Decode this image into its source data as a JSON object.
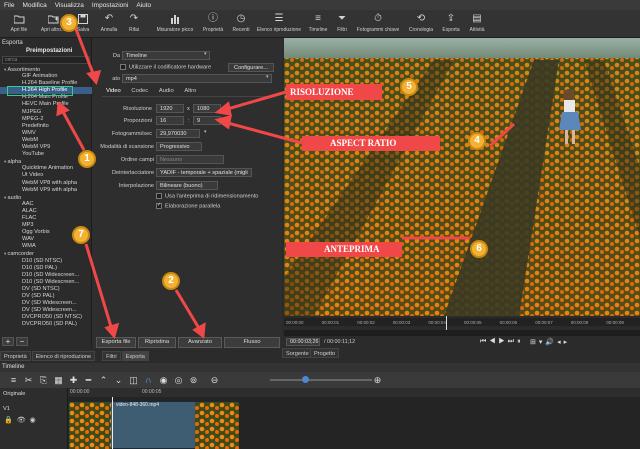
{
  "menu": [
    "File",
    "Modifica",
    "Visualizza",
    "Impostazioni",
    "Aiuto"
  ],
  "toolbar": [
    {
      "icon": "folder-open-icon",
      "label": "Apri file"
    },
    {
      "icon": "open-other-icon",
      "label": "Apri altro..."
    },
    {
      "icon": "save-icon",
      "label": "Salva"
    },
    {
      "icon": "undo-icon",
      "label": "Annulla"
    },
    {
      "icon": "redo-icon",
      "label": "Rifai"
    },
    {
      "icon": "peak-meter-icon",
      "label": "Misuratore picco"
    },
    {
      "icon": "properties-icon",
      "label": "Proprietà"
    },
    {
      "icon": "recent-icon",
      "label": "Recenti"
    },
    {
      "icon": "playlist-icon",
      "label": "Elenco riproduzione"
    },
    {
      "icon": "timeline-icon",
      "label": "Timeline"
    },
    {
      "icon": "filter-icon",
      "label": "Filtri"
    },
    {
      "icon": "keyframes-icon",
      "label": "Fotogrammi chiave"
    },
    {
      "icon": "history-icon",
      "label": "Cronologia"
    },
    {
      "icon": "export-icon",
      "label": "Esporta"
    },
    {
      "icon": "jobs-icon",
      "label": "Attività"
    }
  ],
  "export_panel": {
    "title": "Esporta",
    "presets_label": "Preimpostazioni",
    "search_placeholder": "cerca",
    "presets": [
      {
        "text": "Assortimento",
        "kind": "cat"
      },
      {
        "text": "GIF Animation",
        "kind": "sub"
      },
      {
        "text": "H.264 Baseline Profile",
        "kind": "sub"
      },
      {
        "text": "H.264 High Profile",
        "kind": "sub",
        "selected": true
      },
      {
        "text": "H.264 Main Profile",
        "kind": "sub"
      },
      {
        "text": "HEVC Main Profile",
        "kind": "sub"
      },
      {
        "text": "MJPEG",
        "kind": "sub"
      },
      {
        "text": "MPEG-2",
        "kind": "sub"
      },
      {
        "text": "Predefinito",
        "kind": "sub"
      },
      {
        "text": "WMV",
        "kind": "sub"
      },
      {
        "text": "WebM",
        "kind": "sub"
      },
      {
        "text": "WebM VP9",
        "kind": "sub"
      },
      {
        "text": "YouTube",
        "kind": "sub"
      },
      {
        "text": "alpha",
        "kind": "cat"
      },
      {
        "text": "Quicktime Animation",
        "kind": "sub"
      },
      {
        "text": "Ut Video",
        "kind": "sub"
      },
      {
        "text": "WebM VP8 with alpha",
        "kind": "sub"
      },
      {
        "text": "WebM VP9 with alpha",
        "kind": "sub"
      },
      {
        "text": "audio",
        "kind": "cat"
      },
      {
        "text": "AAC",
        "kind": "sub"
      },
      {
        "text": "ALAC",
        "kind": "sub"
      },
      {
        "text": "FLAC",
        "kind": "sub"
      },
      {
        "text": "MP3",
        "kind": "sub"
      },
      {
        "text": "Ogg Vorbis",
        "kind": "sub"
      },
      {
        "text": "WAV",
        "kind": "sub"
      },
      {
        "text": "WMA",
        "kind": "sub"
      },
      {
        "text": "camcorder",
        "kind": "cat"
      },
      {
        "text": "D10 (SD NTSC)",
        "kind": "sub"
      },
      {
        "text": "D10 (SD PAL)",
        "kind": "sub"
      },
      {
        "text": "D10 (SD Widescreen...",
        "kind": "sub"
      },
      {
        "text": "D10 (SD Widescreen...",
        "kind": "sub"
      },
      {
        "text": "DV (SD NTSC)",
        "kind": "sub"
      },
      {
        "text": "DV (SD PAL)",
        "kind": "sub"
      },
      {
        "text": "DV (SD Widescreen...",
        "kind": "sub"
      },
      {
        "text": "DV (SD Widescreen...",
        "kind": "sub"
      },
      {
        "text": "DVCPRO50 (SD NTSC)",
        "kind": "sub"
      },
      {
        "text": "DVCPRO50 (SD PAL)",
        "kind": "sub"
      }
    ],
    "add_label": "+",
    "remove_label": "−",
    "bottom_tabs": [
      "Proprietà",
      "Elenco di riproduzione",
      "Filtri",
      "Esporta"
    ]
  },
  "settings": {
    "da_label": "Da",
    "da_value": "Timeline",
    "hw_label": "Utilizzare il codificatore hardware",
    "configure_label": "Configurare...",
    "format_label": "ato",
    "format_value": "mp4",
    "tabs": [
      "Video",
      "Codec",
      "Audio",
      "Altro"
    ],
    "res_label": "Risoluzione",
    "res_w": "1920",
    "res_x": "x",
    "res_h": "1080",
    "aspect_label": "Proporzioni",
    "aspect_w": "16",
    "aspect_colon": ":",
    "aspect_h": "9",
    "fps_label": "Fotogrammi/sec",
    "fps_value": "29,970030",
    "scan_label": "Modalità di scansione",
    "scan_value": "Progressivo",
    "field_label": "Ordine campi",
    "field_value": "Nessuno",
    "deint_label": "Deinterlacciatore",
    "deint_value": "YADIF - temporale + spaziale (migli",
    "interp_label": "Interpolazione",
    "interp_value": "Bilineare (buono)",
    "preview_scale_label": "Usa l'anteprima di ridimensionamento",
    "parallel_label": "Elaborazione parallela",
    "export_file_label": "Esporta file",
    "reset_label": "Ripristina",
    "advanced_label": "Avanzato",
    "stream_label": "Flusso"
  },
  "player": {
    "ticks": [
      "00:00:00",
      "00:00:01",
      "00:00:02",
      "00:00:03",
      "00:00:04",
      "00:00:05",
      "00:00:06",
      "00:00:07",
      "00:00:08",
      "00:00:09"
    ],
    "current_time": "00:00:03;26",
    "total_time": "/ 00:00:11;12",
    "source_tab": "Sorgente",
    "project_tab": "Progetto"
  },
  "timeline": {
    "title": "Timeline",
    "track_header": "Originale",
    "track_name": "V1",
    "ruler_start": "00:00:00",
    "ruler_mid": "00:00:05",
    "clip_label": "video-848-360.mp4"
  },
  "annotations": {
    "risoluzione": "RISOLUZIONE",
    "aspect": "ASPECT RATIO",
    "anteprima": "ANTEPRIMA",
    "badges": [
      "1",
      "2",
      "3",
      "4",
      "5",
      "6",
      "7"
    ]
  },
  "colors": {
    "callout_red": "#f04848",
    "badge_orange": "#f3b233",
    "selection_blue": "#3b5f8a",
    "highlight_green": "#2fd08a"
  }
}
